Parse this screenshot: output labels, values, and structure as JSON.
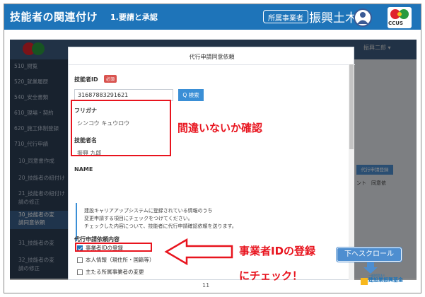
{
  "header": {
    "title": "技能者の関連付け",
    "step": "1.要請と承認",
    "role_badge": "所属事業者",
    "company": "振興土木"
  },
  "logo": {
    "ccus_text": "CCUS"
  },
  "app": {
    "user": "振興二郎 ▾",
    "sidebar": [
      "510_閲覧",
      "520_就業履歴",
      "540_安全書類",
      "610_現場・契約",
      "620_施工体制登録",
      "710_代行申請",
      "10_同意書作成",
      "20_技能者の紐付け",
      "21_技能者の紐付け",
      "請の修正",
      "30_技能者の変",
      "請同意依頼",
      "31_技能者の変",
      "32_技能者の変",
      "請の修正"
    ],
    "bg_button": "代行申請登録",
    "bg_row": "ント　同意依"
  },
  "modal": {
    "title": "代行申請同意依頼",
    "id_label": "技能者ID",
    "required": "必須",
    "id_value": "31687883291621",
    "search_label": "Q 検索",
    "furigana_label": "フリガナ",
    "furigana_value": "シンコウ キュウロウ",
    "name_label": "技能者名",
    "name_value": "振興 九郎",
    "name_en_label": "NAME",
    "info": [
      "建設キャリアアップシステムに登録されている情報のうち",
      "変更申請する項目にチェックをつけてください。",
      "チェックした内容について、技能者に代行申請確認依頼を送ります。"
    ],
    "request_label": "代行申請依頼内容",
    "options": [
      {
        "label": "事業者IDの登録",
        "checked": true
      },
      {
        "label": "本人情報（現住所・国籍等）",
        "checked": false
      },
      {
        "label": "主たる所属事業者の変更",
        "checked": false
      }
    ]
  },
  "annotations": {
    "confirm": "間違いないか確認",
    "check_line1": "事業者IDの登録",
    "check_line2": "にチェック！",
    "scroll_button": "下へスクロール"
  },
  "footer": {
    "page": "11",
    "org_sub": "一般財団法人",
    "org": "建設業振興基金"
  },
  "colors": {
    "header_blue": "#1e74b9",
    "annotation_red": "#e8141e",
    "sidebar_dark": "#2c3e55"
  }
}
